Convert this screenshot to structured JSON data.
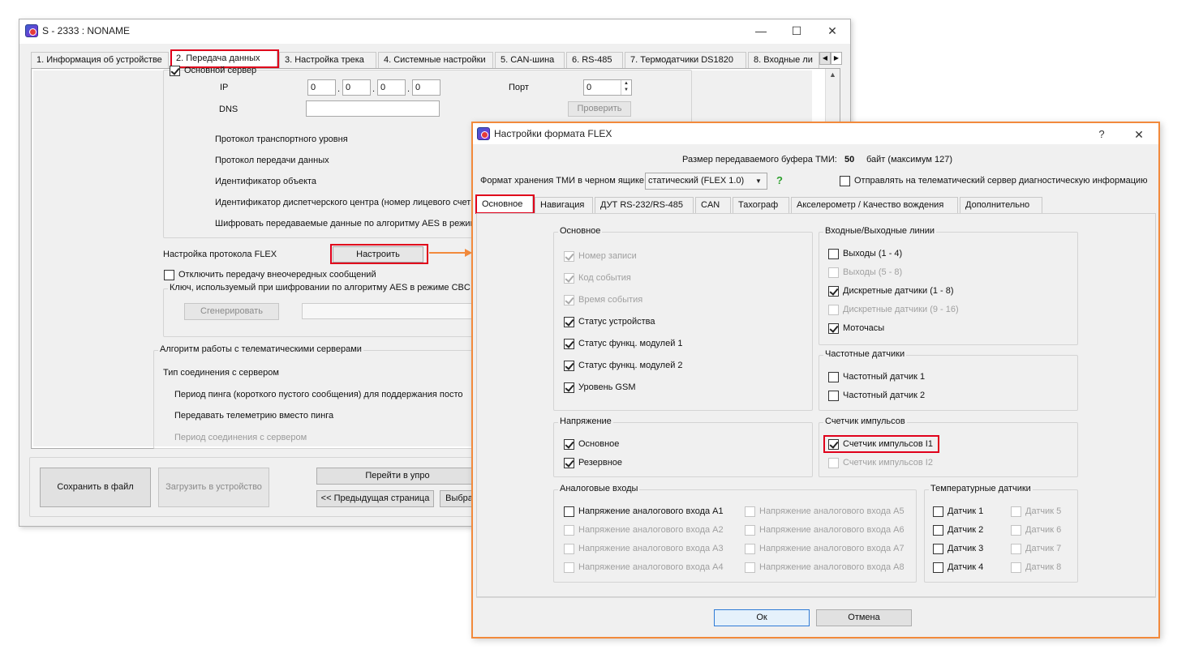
{
  "main": {
    "title": "S - 2333 : NONAME",
    "tabs": [
      "1. Информация об устройстве",
      "2. Передача данных",
      "3. Настройка трека",
      "4. Системные настройки",
      "5. CAN-шина",
      "6. RS-485",
      "7. Термодатчики DS1820",
      "8. Входные ли"
    ],
    "primary_server": "Основной сервер",
    "ip_label": "IP",
    "ip": [
      "0",
      "0",
      "0",
      "0"
    ],
    "port_label": "Порт",
    "port": "0",
    "dns_label": "DNS",
    "dns": "",
    "check_btn": "Проверить",
    "rows": [
      "Протокол транспортного уровня",
      "Протокол передачи данных",
      "Идентификатор объекта",
      "Идентификатор диспетчерского центра (номер лицевого счет",
      "Шифровать передаваемые данные по алгоритму AES в режим"
    ],
    "flex_label": "Настройка протокола FLEX",
    "flex_btn": "Настроить",
    "disable_extra": "Отключить передачу внеочередных сообщений",
    "aes_key_label": "Ключ, используемый при шифровании по алгоритму AES в режиме CBC",
    "generate_btn": "Сгенерировать",
    "algo_group": "Алгоритм работы с телематическими серверами",
    "algo_rows": [
      "Тип соединения с сервером",
      "Период пинга (короткого пустого сообщения) для поддержания посто",
      "Передавать телеметрию вместо пинга",
      "Период соединения с сервером"
    ],
    "save_btn": "Сохранить в файл",
    "load_btn": "Загрузить в устройство",
    "goto_btn": "Перейти в упро",
    "prev_btn": "<<  Предыдущая страница",
    "select_btn": "Выбра"
  },
  "dialog": {
    "title": "Настройки формата FLEX",
    "help": "?",
    "close": "✕",
    "buffer_label": "Размер передаваемого буфера ТМИ:",
    "buffer_value": "50",
    "buffer_suffix": "байт (максимум 127)",
    "storage_label": "Формат хранения ТМИ в черном ящике",
    "storage_value": "статический (FLEX 1.0)",
    "help_q": "?",
    "send_diag": "Отправлять на телематический сервер диагностическую информацию",
    "tabs": [
      "Основное",
      "Навигация",
      "ДУТ RS-232/RS-485",
      "CAN",
      "Тахограф",
      "Акселерометр / Качество вождения",
      "Дополнительно"
    ],
    "groups": {
      "basic": {
        "title": "Основное",
        "items": [
          {
            "label": "Номер записи",
            "checked": true,
            "disabled": true
          },
          {
            "label": "Код события",
            "checked": true,
            "disabled": true
          },
          {
            "label": "Время события",
            "checked": true,
            "disabled": true
          },
          {
            "label": "Статус устройства",
            "checked": true,
            "disabled": false
          },
          {
            "label": "Статус функц. модулей 1",
            "checked": true,
            "disabled": false
          },
          {
            "label": "Статус функц. модулей 2",
            "checked": true,
            "disabled": false
          },
          {
            "label": "Уровень GSM",
            "checked": true,
            "disabled": false
          }
        ]
      },
      "io": {
        "title": "Входные/Выходные линии",
        "items": [
          {
            "label": "Выходы (1 - 4)",
            "checked": false,
            "disabled": false
          },
          {
            "label": "Выходы (5 - 8)",
            "checked": false,
            "disabled": true
          },
          {
            "label": "Дискретные датчики (1 - 8)",
            "checked": true,
            "disabled": false
          },
          {
            "label": "Дискретные датчики (9 - 16)",
            "checked": false,
            "disabled": true
          },
          {
            "label": "Моточасы",
            "checked": true,
            "disabled": false
          }
        ]
      },
      "freq": {
        "title": "Частотные датчики",
        "items": [
          {
            "label": "Частотный датчик 1",
            "checked": false,
            "disabled": false
          },
          {
            "label": "Частотный датчик 2",
            "checked": false,
            "disabled": false
          }
        ]
      },
      "voltage": {
        "title": "Напряжение",
        "items": [
          {
            "label": "Основное",
            "checked": true,
            "disabled": false
          },
          {
            "label": "Резервное",
            "checked": true,
            "disabled": false
          }
        ]
      },
      "pulse": {
        "title": "Счетчик импульсов",
        "items": [
          {
            "label": "Счетчик импульсов I1",
            "checked": true,
            "disabled": false
          },
          {
            "label": "Счетчик импульсов I2",
            "checked": false,
            "disabled": true
          }
        ]
      },
      "analog": {
        "title": "Аналоговые входы",
        "items": [
          {
            "label": "Напряжение аналогового входа A1",
            "checked": false,
            "disabled": false
          },
          {
            "label": "Напряжение аналогового входа A2",
            "checked": false,
            "disabled": true
          },
          {
            "label": "Напряжение аналогового входа A3",
            "checked": false,
            "disabled": true
          },
          {
            "label": "Напряжение аналогового входа A4",
            "checked": false,
            "disabled": true
          },
          {
            "label": "Напряжение аналогового входа A5",
            "checked": false,
            "disabled": true
          },
          {
            "label": "Напряжение аналогового входа A6",
            "checked": false,
            "disabled": true
          },
          {
            "label": "Напряжение аналогового входа A7",
            "checked": false,
            "disabled": true
          },
          {
            "label": "Напряжение аналогового входа A8",
            "checked": false,
            "disabled": true
          }
        ]
      },
      "temp": {
        "title": "Температурные датчики",
        "items": [
          {
            "label": "Датчик 1",
            "checked": false,
            "disabled": false
          },
          {
            "label": "Датчик 2",
            "checked": false,
            "disabled": false
          },
          {
            "label": "Датчик 3",
            "checked": false,
            "disabled": false
          },
          {
            "label": "Датчик 4",
            "checked": false,
            "disabled": false
          },
          {
            "label": "Датчик 5",
            "checked": false,
            "disabled": true
          },
          {
            "label": "Датчик 6",
            "checked": false,
            "disabled": true
          },
          {
            "label": "Датчик 7",
            "checked": false,
            "disabled": true
          },
          {
            "label": "Датчик 8",
            "checked": false,
            "disabled": true
          }
        ]
      }
    },
    "ok": "Ок",
    "cancel": "Отмена"
  },
  "colors": {
    "highlight": "#e0001b",
    "dialog_border": "#f28a3c",
    "arrow": "#f28a3c"
  }
}
